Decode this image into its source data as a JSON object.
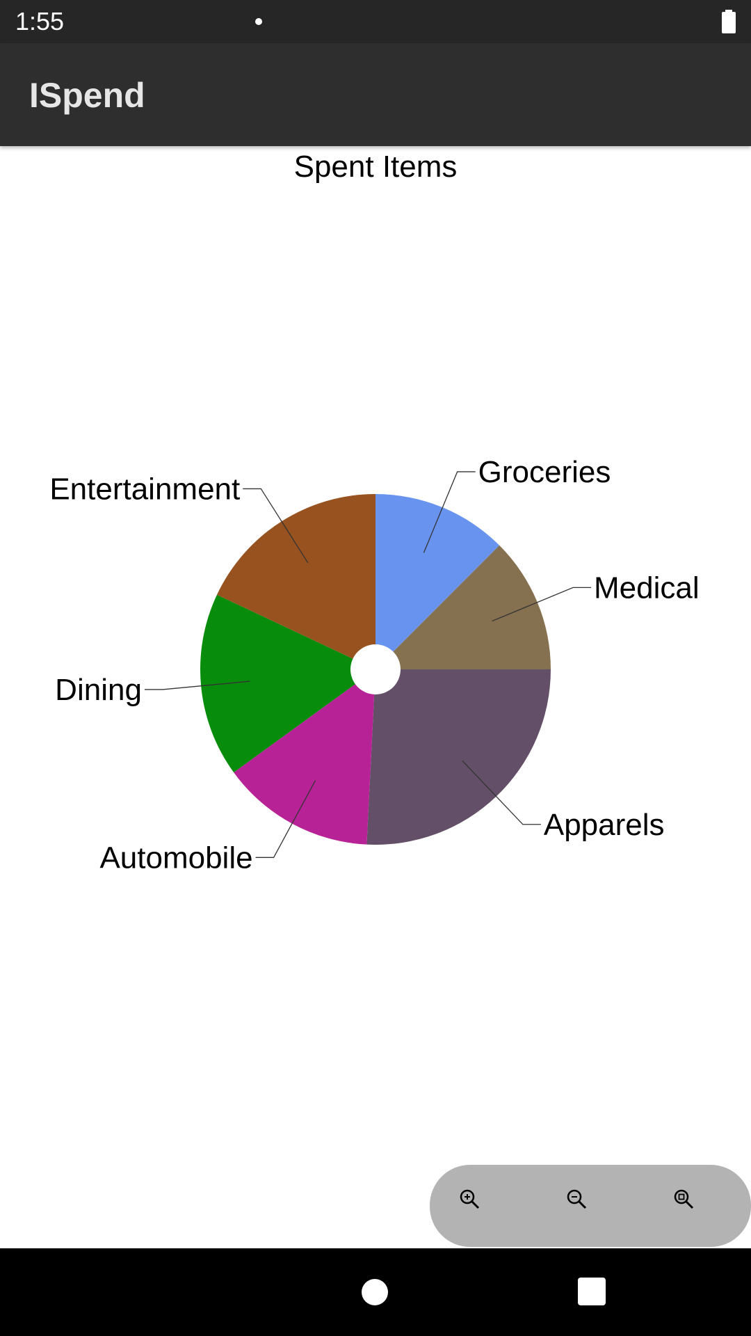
{
  "status_bar": {
    "time": "1:55",
    "icons": [
      "notification-dot-icon",
      "battery-full-icon"
    ]
  },
  "app_bar": {
    "title": "ISpend"
  },
  "zoom_controls": {
    "icons": [
      "zoom-in-icon",
      "zoom-out-icon",
      "zoom-reset-icon"
    ]
  },
  "nav_bar": {
    "icons": [
      "home-icon",
      "recents-icon"
    ]
  },
  "chart_data": {
    "type": "pie",
    "title": "Spent Items",
    "donut_hole": true,
    "slices": [
      {
        "label": "Groceries",
        "value": 12.5,
        "color": "#6894f0"
      },
      {
        "label": "Medical",
        "value": 12.5,
        "color": "#857150"
      },
      {
        "label": "Apparels",
        "value": 25.8,
        "color": "#634f68"
      },
      {
        "label": "Automobile",
        "value": 14.2,
        "color": "#b72396"
      },
      {
        "label": "Dining",
        "value": 17.0,
        "color": "#088c0c"
      },
      {
        "label": "Entertainment",
        "value": 18.0,
        "color": "#97521f"
      }
    ]
  }
}
